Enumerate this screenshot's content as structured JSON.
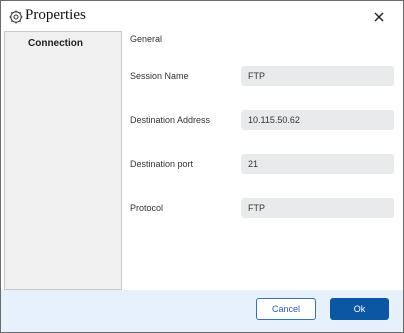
{
  "window": {
    "title": "Properties",
    "title_icon": "gear-icon",
    "close_icon": "close-icon"
  },
  "sidebar": {
    "items": [
      {
        "label": "Connection",
        "selected": true
      }
    ]
  },
  "main": {
    "section_title": "General",
    "fields": [
      {
        "label": "Session Name",
        "value": "FTP"
      },
      {
        "label": "Destination Address",
        "value": "10.115.50.62"
      },
      {
        "label": "Destination port",
        "value": "21"
      },
      {
        "label": "Protocol",
        "value": "FTP"
      }
    ]
  },
  "footer": {
    "cancel_label": "Cancel",
    "ok_label": "Ok"
  },
  "colors": {
    "accent": "#0b57a3",
    "footer_bg": "#e6f1fb",
    "input_bg": "#e9eaeb",
    "sidebar_bg": "#f0f0f0"
  }
}
